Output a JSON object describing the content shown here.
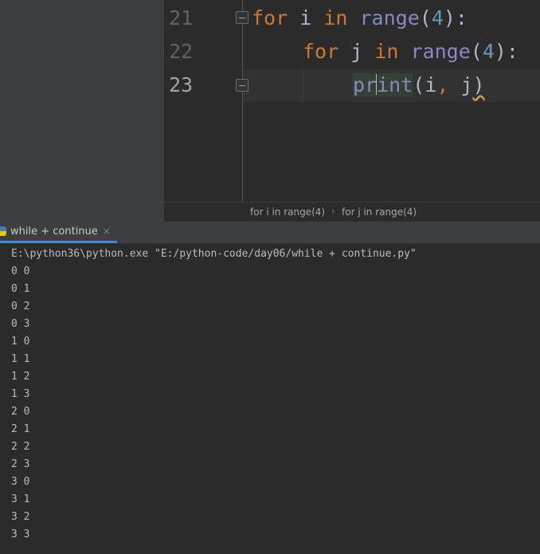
{
  "editor": {
    "lines": [
      {
        "num": "21",
        "tokens": [
          {
            "t": "for",
            "c": "kw"
          },
          {
            "t": " i ",
            "c": "op"
          },
          {
            "t": "in",
            "c": "kw"
          },
          {
            "t": " ",
            "c": "op"
          },
          {
            "t": "range",
            "c": "fn"
          },
          {
            "t": "(",
            "c": "op"
          },
          {
            "t": "4",
            "c": "num"
          },
          {
            "t": "):",
            "c": "op"
          }
        ]
      },
      {
        "num": "22",
        "tokens": [
          {
            "t": "for",
            "c": "kw"
          },
          {
            "t": " j ",
            "c": "op"
          },
          {
            "t": "in",
            "c": "kw"
          },
          {
            "t": " ",
            "c": "op"
          },
          {
            "t": "range",
            "c": "fn"
          },
          {
            "t": "(",
            "c": "op"
          },
          {
            "t": "4",
            "c": "num"
          },
          {
            "t": "):",
            "c": "op"
          }
        ]
      },
      {
        "num": "23",
        "tokens": [
          {
            "t": "pr",
            "c": "fn hl"
          },
          {
            "t": "|",
            "c": "caret"
          },
          {
            "t": "int",
            "c": "fn hl"
          },
          {
            "t": "(i",
            "c": "op"
          },
          {
            "t": ",",
            "c": "kw"
          },
          {
            "t": " j",
            "c": "op"
          },
          {
            "t": ")",
            "c": "op squiggle"
          }
        ]
      }
    ]
  },
  "breadcrumb": {
    "items": [
      "for i in range(4)",
      "for j in range(4)"
    ],
    "separator": "›"
  },
  "run_tab": {
    "label": "while + continue",
    "close": "×"
  },
  "console": {
    "lines": [
      "E:\\python36\\python.exe \"E:/python-code/day06/while + continue.py\"",
      "0 0",
      "0 1",
      "0 2",
      "0 3",
      "1 0",
      "1 1",
      "1 2",
      "1 3",
      "2 0",
      "2 1",
      "2 2",
      "2 3",
      "3 0",
      "3 1",
      "3 2",
      "3 3"
    ]
  }
}
